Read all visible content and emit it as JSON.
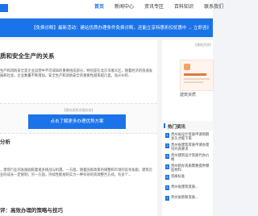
{
  "nav": {
    "items": [
      "首页",
      "新闻中心",
      "资讯专区",
      "百科知识",
      "联系我们"
    ]
  },
  "banner": {
    "text": "【免费诊断】最新活动：建站优质办理条件免费诊断，还能立享特惠折扣优惠中 → 立即咨询"
  },
  "article": {
    "title": "质和安全生产的关系",
    "paragraph": "生产和消防安全是企业运营中不可或缺的重要组成部分，特别是在北京市顺义区，随着经济的快速发展和社会，企业数量不断增加，安全生产和消防安全的重要性越来越凸显。海义州的...",
    "promo_small": "【建站资质办理业务】",
    "promo_button": "点击了解更多办理优势方案",
    "section_heading": "分析",
    "section2_heading": "评：高效办理的策略与技巧",
    "paragraph2": "，建筑行业的发展面临着诸多挑战与机遇。一方面，随着国家政策的调整和市场的竞争加剧，建筑企业的成长一定限制；另一方面，持续性能规的实力一种有效的资源整合方式，有多个..."
  },
  "sidebar": {
    "card_label": "【建筑资质】",
    "card_caption": "建筑资质"
  },
  "hot": {
    "title": "热门资讯",
    "items": [
      "贵州省设计资质申请周期多久才能下来",
      "贵州省建筑资质申请办理对开具要求",
      "贵州建筑设计资质代办价格",
      "贵州新办资质需要提供哪些材料",
      "资质标准",
      "贵州省建筑资质...",
      "贵州省新和资质..."
    ]
  }
}
